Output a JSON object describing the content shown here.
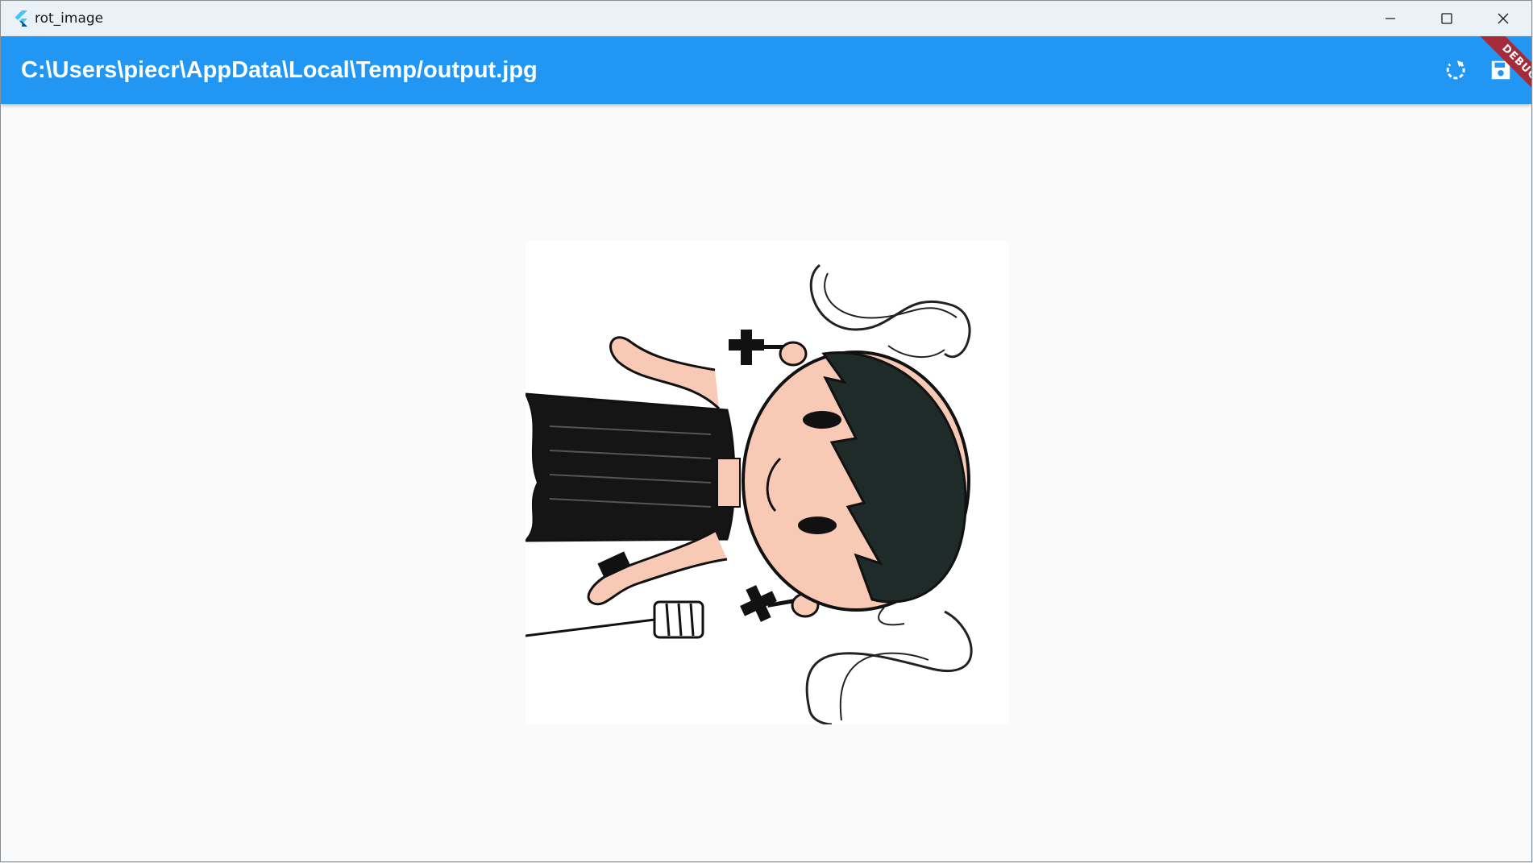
{
  "window": {
    "title": "rot_image"
  },
  "appbar": {
    "title": "C:\\Users\\piecr\\AppData\\Local\\Temp/output.jpg",
    "color": "#2196f3"
  },
  "debug_banner": {
    "label": "DEBUG",
    "color": "#a32b3a"
  },
  "icons": {
    "app": "flutter-logo-icon",
    "minimize": "minimize-icon",
    "maximize": "maximize-icon",
    "close": "close-icon",
    "rotate": "rotate-icon",
    "save": "save-icon"
  }
}
